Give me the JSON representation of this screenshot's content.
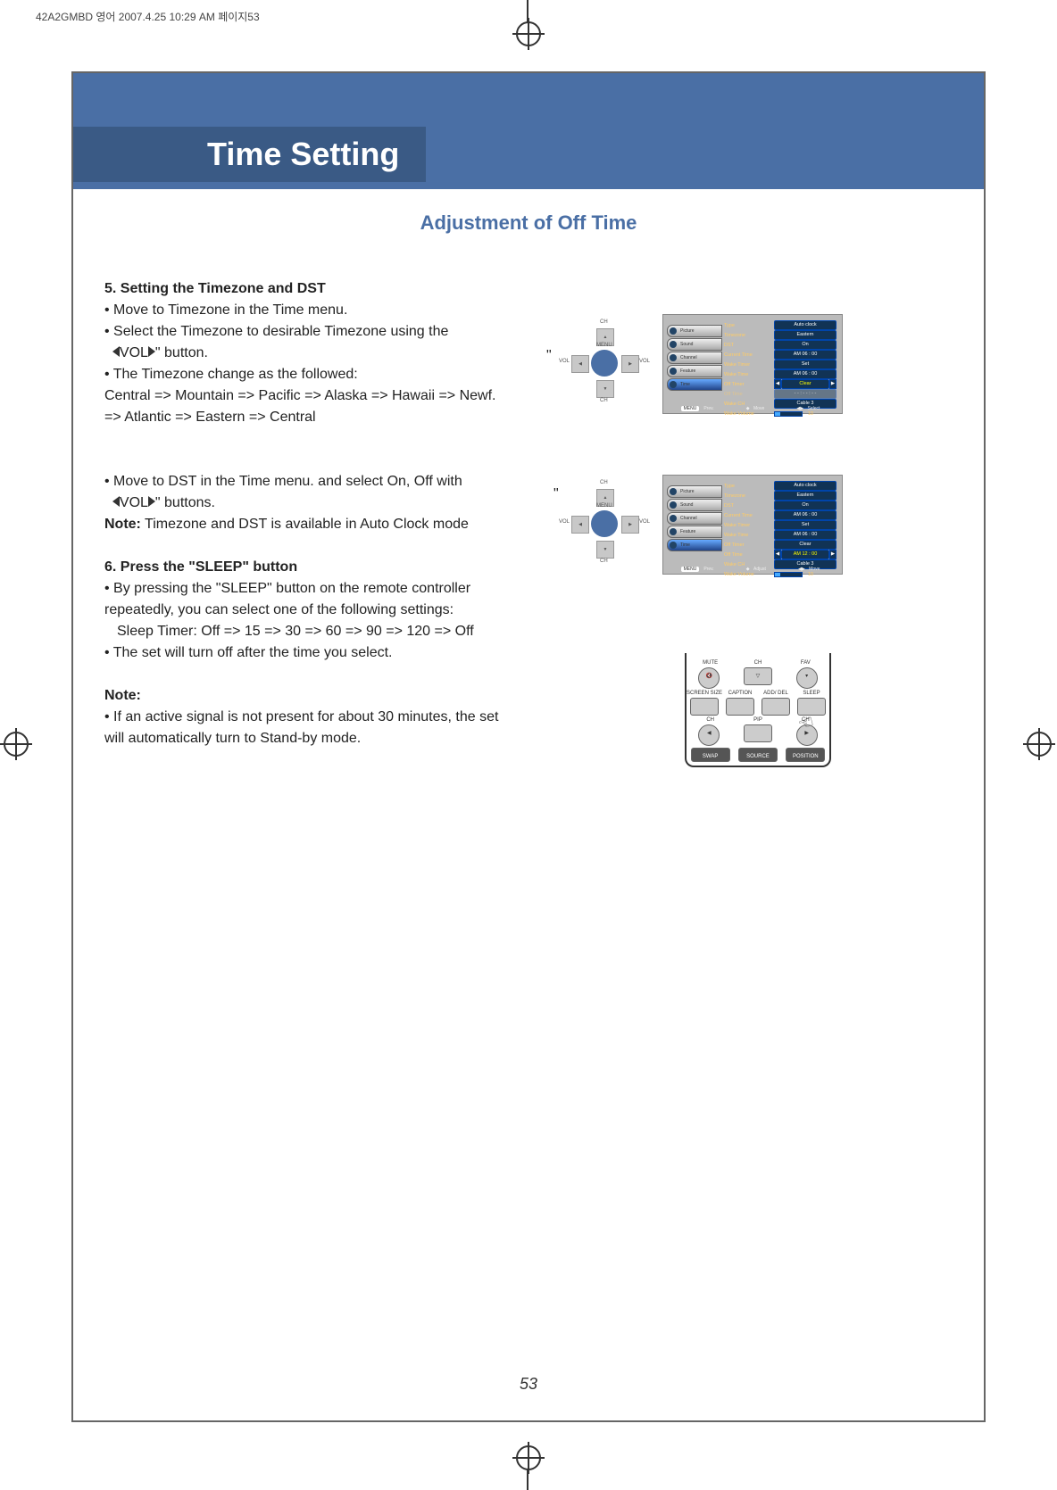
{
  "header_strip": "42A2GMBD 영어  2007.4.25 10:29 AM 페이지53",
  "banner_title": "Time Setting",
  "section_title": "Adjustment of Off Time",
  "step5": {
    "heading": "5. Setting the Timezone and DST",
    "b1": "• Move to Timezone in the Time menu.",
    "b2_pre": "• Select the Timezone to desirable Timezone using the",
    "b2_btn": "VOL",
    "b2_post": "\" button.",
    "b3": "• The Timezone change as the followed:",
    "seq": "Central => Mountain => Pacific => Alaska => Hawaii => Newf. => Atlantic => Eastern => Central"
  },
  "dst": {
    "line_pre": "• Move to DST in the Time menu. and select On, Off with",
    "btn": "VOL",
    "line_post": "\" buttons.",
    "note_label": "Note:",
    "note": " Timezone and DST is available in Auto Clock mode"
  },
  "step6": {
    "heading": "6. Press the \"SLEEP\" button",
    "b1": "• By pressing the \"SLEEP\" button on the remote controller repeatedly, you can select one of the following settings:",
    "seq": "Sleep Timer: Off => 15  => 30 => 60 => 90 => 120 => Off",
    "b2": "• The set will turn off after the time you select."
  },
  "final_note": {
    "label": "Note:",
    "text": "• If an active signal is not present for about 30 minutes, the set will automatically turn to Stand-by mode."
  },
  "dpad": {
    "ch": "CH",
    "menu": "MENU",
    "vol": "VOL"
  },
  "osd": {
    "tabs": [
      "Picture",
      "Sound",
      "Channel",
      "Feature",
      "Time"
    ],
    "rows1": [
      {
        "k": "Type",
        "v": "Auto clock"
      },
      {
        "k": "Timezone",
        "v": "Eastern"
      },
      {
        "k": "DST",
        "v": "On"
      },
      {
        "k": "Current Time",
        "v": "AM 06 : 00"
      },
      {
        "k": "Wake Timer",
        "v": "Set"
      },
      {
        "k": "Wake Time",
        "v": "AM 06 : 00"
      },
      {
        "k": "Off Timer",
        "v": "Clear",
        "arrows": true
      },
      {
        "k": "Off Time",
        "v": "- - : - - : - -",
        "dim": true
      },
      {
        "k": "Wake CH",
        "v": "Cable 3"
      },
      {
        "k": "Wake Volume",
        "v": "__bar__",
        "r": "10"
      }
    ],
    "rows2": [
      {
        "k": "Type",
        "v": "Auto clock"
      },
      {
        "k": "Timezone",
        "v": "Eastern"
      },
      {
        "k": "DST",
        "v": "On"
      },
      {
        "k": "Current Time",
        "v": "AM 06 : 00"
      },
      {
        "k": "Wake Timer",
        "v": "Set"
      },
      {
        "k": "Wake Time",
        "v": "AM 06 : 00"
      },
      {
        "k": "Off Timer",
        "v": "Clear"
      },
      {
        "k": "Off Time",
        "v": "AM 12 : 00",
        "arrows": true
      },
      {
        "k": "Wake CH",
        "v": "Cable 3"
      },
      {
        "k": "Wake Volume",
        "v": "__bar__",
        "r": "10"
      }
    ],
    "foot1": {
      "prev": "MENU",
      "prev_t": "Prev.",
      "mid": "Move",
      "sel": "Select"
    },
    "foot2": {
      "prev": "MENU",
      "prev_t": "Prev.",
      "mid": "Adjust",
      "sel": "Move"
    }
  },
  "remote": {
    "mute": "MUTE",
    "fav": "FAV",
    "ch": "CH",
    "screen": "SCREEN SIZE",
    "caption": "CAPTION",
    "add": "ADD/ DEL",
    "sleep": "SLEEP",
    "pip": "PIP",
    "swap": "SWAP",
    "source": "SOURCE",
    "position": "POSITION"
  },
  "page_number": "53",
  "quote_mark": "\""
}
